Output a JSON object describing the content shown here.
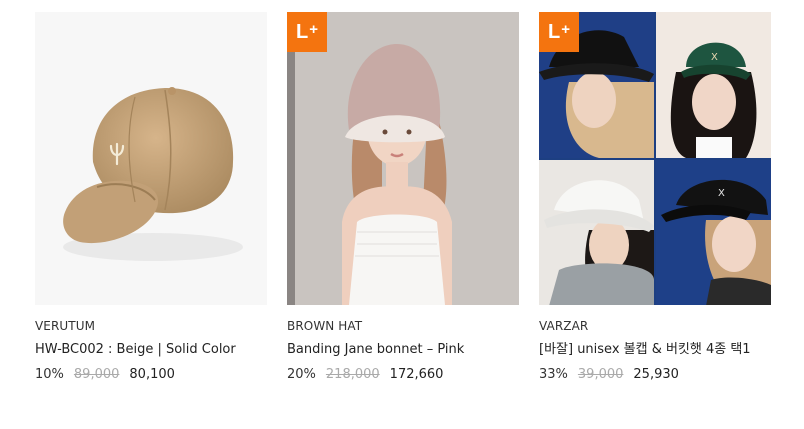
{
  "products": [
    {
      "brand": "VERUTUM",
      "name": "HW-BC002 : Beige | Solid Color",
      "discount": "10%",
      "original_price": "89,000",
      "price": "80,100",
      "badge": ""
    },
    {
      "brand": "BROWN HAT",
      "name": "Banding Jane bonnet – Pink",
      "discount": "20%",
      "original_price": "218,000",
      "price": "172,660",
      "badge": "L"
    },
    {
      "brand": "VARZAR",
      "name": "[바잘] unisex 볼캡 & 버킷햇 4종 택1",
      "discount": "33%",
      "original_price": "39,000",
      "price": "25,930",
      "badge": "L"
    }
  ],
  "colors": {
    "badge": "#f4740f",
    "strike_price": "#aaaaaa"
  },
  "icons": [
    "l-plus-badge-icon"
  ]
}
